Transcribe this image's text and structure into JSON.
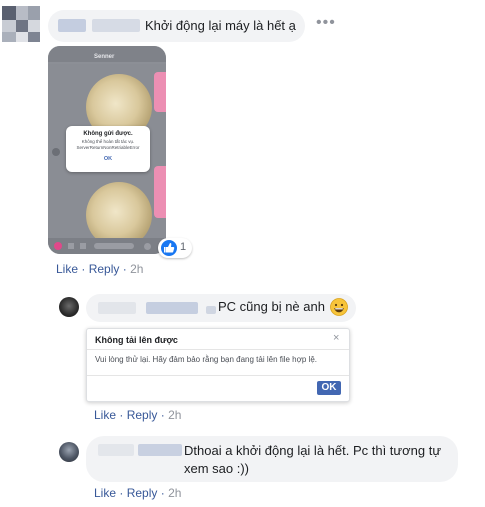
{
  "comment1": {
    "text": "Khởi động lại máy là hết ạ",
    "options_icon": "ellipsis-icon",
    "like_label": "Like",
    "reply_label": "Reply",
    "time": "2h",
    "reaction_count": "1",
    "reaction_icon": "thumbs-up-icon",
    "attachment": {
      "chat_title": "Senner",
      "dialog_title": "Không gửi được.",
      "dialog_message": "Không thể hoàn tất tác vụ. ServerReturnNonRetriableError",
      "dialog_ok": "OK"
    }
  },
  "reply1": {
    "text": "PC cũng bị nè anh",
    "emoji": "grinning-face-emoji",
    "like_label": "Like",
    "reply_label": "Reply",
    "time": "2h",
    "attachment": {
      "dialog_title": "Không tải lên được",
      "dialog_message": "Vui lòng thử lại. Hãy đảm bảo rằng bạn đang tải lên file hợp lệ.",
      "dialog_close": "×",
      "dialog_ok": "OK"
    }
  },
  "reply2": {
    "text": "Dthoai a khởi động lại là hết. Pc thì tương tự xem sao :))",
    "like_label": "Like",
    "reply_label": "Reply",
    "time": "2h"
  }
}
